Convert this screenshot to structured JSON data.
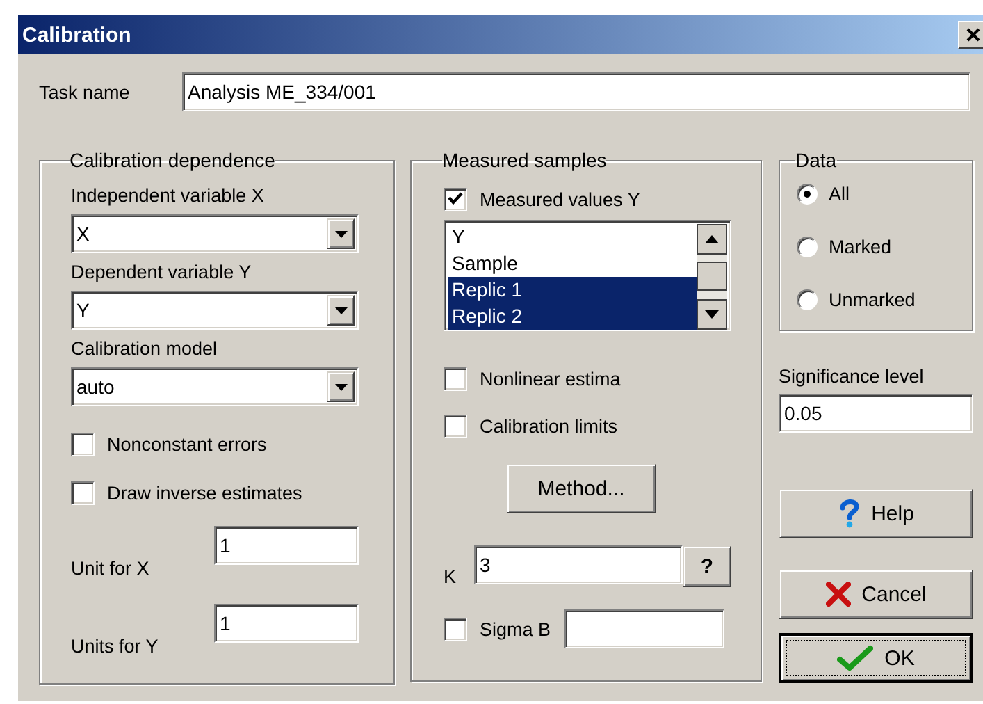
{
  "window": {
    "title": "Calibration"
  },
  "task_name": {
    "label": "Task name",
    "value": "Analysis ME_334/001"
  },
  "calibration_dependence": {
    "title": "Calibration dependence",
    "dropdowns": [
      {
        "label": "Independent variable X",
        "value": "X"
      },
      {
        "label": "Dependent variable Y",
        "value": "Y"
      },
      {
        "label": "Calibration model",
        "value": "auto"
      }
    ],
    "checkboxes": [
      {
        "label": "Nonconstant errors",
        "checked": false
      },
      {
        "label": "Draw inverse estimates",
        "checked": false
      }
    ],
    "units": [
      {
        "label": "Unit for X",
        "value": "1"
      },
      {
        "label": "Units for Y",
        "value": "1"
      }
    ]
  },
  "measured_samples": {
    "title": "Measured samples",
    "measured_values": {
      "label": "Measured values Y",
      "checked": true
    },
    "list_items": [
      {
        "label": "Y",
        "selected": false
      },
      {
        "label": "Sample",
        "selected": false
      },
      {
        "label": "Replic 1",
        "selected": true
      },
      {
        "label": "Replic 2",
        "selected": true
      }
    ],
    "checkboxes": [
      {
        "label": "Nonlinear estima",
        "checked": false
      },
      {
        "label": "Calibration limits",
        "checked": false
      }
    ],
    "method_button": "Method...",
    "k": {
      "label": "K",
      "value": "3",
      "help_button": "?"
    },
    "sigma_b": {
      "label": "Sigma B",
      "checked": false
    }
  },
  "data": {
    "title": "Data",
    "options": [
      {
        "label": "All",
        "selected": true
      },
      {
        "label": "Marked",
        "selected": false
      },
      {
        "label": "Unmarked",
        "selected": false
      }
    ]
  },
  "significance": {
    "label": "Significance level",
    "value": "0.05"
  },
  "buttons": [
    {
      "kind": "help",
      "label": "Help",
      "default": false
    },
    {
      "kind": "cancel",
      "label": "Cancel",
      "default": false
    },
    {
      "kind": "ok",
      "label": "OK",
      "default": true
    }
  ]
}
